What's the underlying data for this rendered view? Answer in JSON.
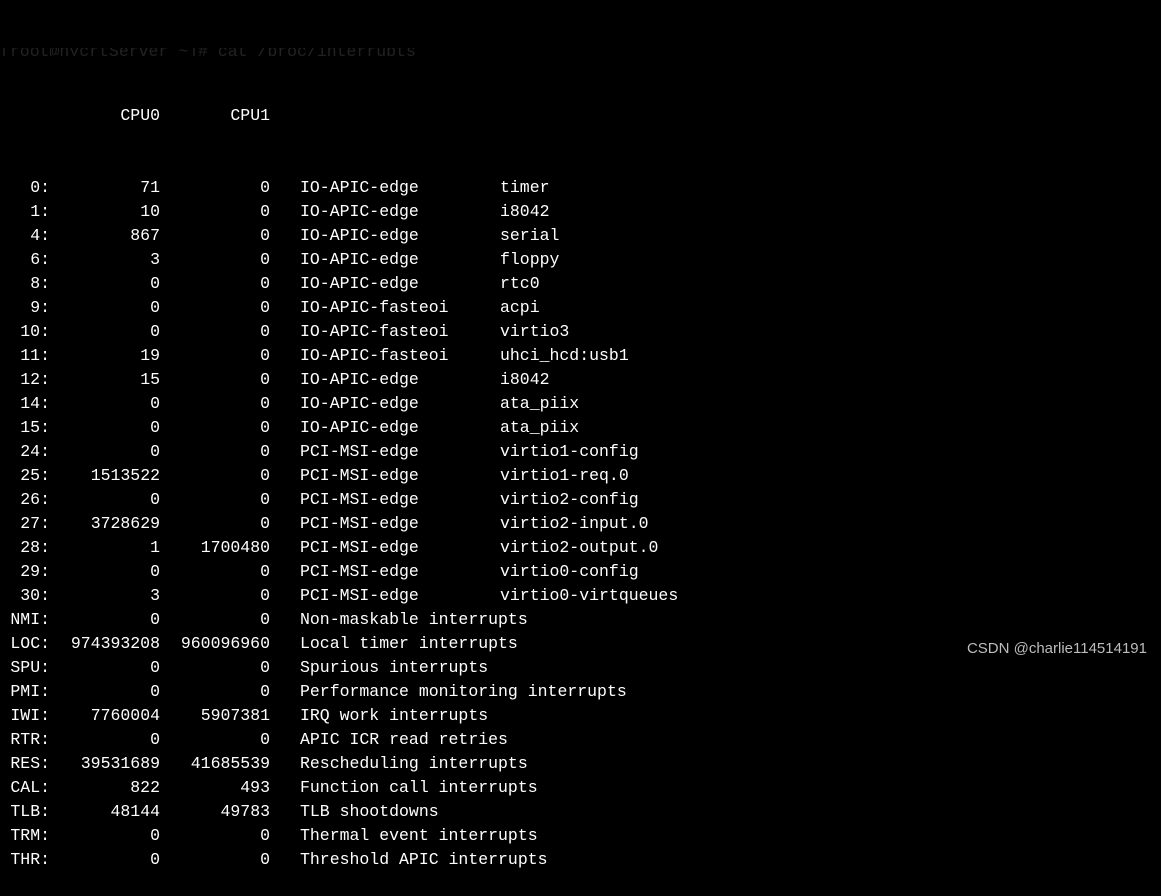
{
  "prompt": "[root@hycrtServer ~]# cat /proc/interrupts",
  "header": {
    "cpu0": "CPU0",
    "cpu1": "CPU1"
  },
  "rows": [
    {
      "irq": "0:",
      "c0": "71",
      "c1": "0",
      "type": "IO-APIC-edge",
      "desc": "timer"
    },
    {
      "irq": "1:",
      "c0": "10",
      "c1": "0",
      "type": "IO-APIC-edge",
      "desc": "i8042"
    },
    {
      "irq": "4:",
      "c0": "867",
      "c1": "0",
      "type": "IO-APIC-edge",
      "desc": "serial"
    },
    {
      "irq": "6:",
      "c0": "3",
      "c1": "0",
      "type": "IO-APIC-edge",
      "desc": "floppy"
    },
    {
      "irq": "8:",
      "c0": "0",
      "c1": "0",
      "type": "IO-APIC-edge",
      "desc": "rtc0"
    },
    {
      "irq": "9:",
      "c0": "0",
      "c1": "0",
      "type": "IO-APIC-fasteoi",
      "desc": "acpi"
    },
    {
      "irq": "10:",
      "c0": "0",
      "c1": "0",
      "type": "IO-APIC-fasteoi",
      "desc": "virtio3"
    },
    {
      "irq": "11:",
      "c0": "19",
      "c1": "0",
      "type": "IO-APIC-fasteoi",
      "desc": "uhci_hcd:usb1"
    },
    {
      "irq": "12:",
      "c0": "15",
      "c1": "0",
      "type": "IO-APIC-edge",
      "desc": "i8042"
    },
    {
      "irq": "14:",
      "c0": "0",
      "c1": "0",
      "type": "IO-APIC-edge",
      "desc": "ata_piix"
    },
    {
      "irq": "15:",
      "c0": "0",
      "c1": "0",
      "type": "IO-APIC-edge",
      "desc": "ata_piix"
    },
    {
      "irq": "24:",
      "c0": "0",
      "c1": "0",
      "type": "PCI-MSI-edge",
      "desc": "virtio1-config"
    },
    {
      "irq": "25:",
      "c0": "1513522",
      "c1": "0",
      "type": "PCI-MSI-edge",
      "desc": "virtio1-req.0"
    },
    {
      "irq": "26:",
      "c0": "0",
      "c1": "0",
      "type": "PCI-MSI-edge",
      "desc": "virtio2-config"
    },
    {
      "irq": "27:",
      "c0": "3728629",
      "c1": "0",
      "type": "PCI-MSI-edge",
      "desc": "virtio2-input.0"
    },
    {
      "irq": "28:",
      "c0": "1",
      "c1": "1700480",
      "type": "PCI-MSI-edge",
      "desc": "virtio2-output.0"
    },
    {
      "irq": "29:",
      "c0": "0",
      "c1": "0",
      "type": "PCI-MSI-edge",
      "desc": "virtio0-config"
    },
    {
      "irq": "30:",
      "c0": "3",
      "c1": "0",
      "type": "PCI-MSI-edge",
      "desc": "virtio0-virtqueues"
    },
    {
      "irq": "NMI:",
      "c0": "0",
      "c1": "0",
      "type": "Non-maskable interrupts",
      "desc": ""
    },
    {
      "irq": "LOC:",
      "c0": "974393208",
      "c1": "960096960",
      "type": "Local timer interrupts",
      "desc": ""
    },
    {
      "irq": "SPU:",
      "c0": "0",
      "c1": "0",
      "type": "Spurious interrupts",
      "desc": ""
    },
    {
      "irq": "PMI:",
      "c0": "0",
      "c1": "0",
      "type": "Performance monitoring interrupts",
      "desc": ""
    },
    {
      "irq": "IWI:",
      "c0": "7760004",
      "c1": "5907381",
      "type": "IRQ work interrupts",
      "desc": ""
    },
    {
      "irq": "RTR:",
      "c0": "0",
      "c1": "0",
      "type": "APIC ICR read retries",
      "desc": ""
    },
    {
      "irq": "RES:",
      "c0": "39531689",
      "c1": "41685539",
      "type": "Rescheduling interrupts",
      "desc": ""
    },
    {
      "irq": "CAL:",
      "c0": "822",
      "c1": "493",
      "type": "Function call interrupts",
      "desc": ""
    },
    {
      "irq": "TLB:",
      "c0": "48144",
      "c1": "49783",
      "type": "TLB shootdowns",
      "desc": ""
    },
    {
      "irq": "TRM:",
      "c0": "0",
      "c1": "0",
      "type": "Thermal event interrupts",
      "desc": ""
    },
    {
      "irq": "THR:",
      "c0": "0",
      "c1": "0",
      "type": "Threshold APIC interrupts",
      "desc": ""
    }
  ],
  "watermark": "CSDN @charlie114514191"
}
